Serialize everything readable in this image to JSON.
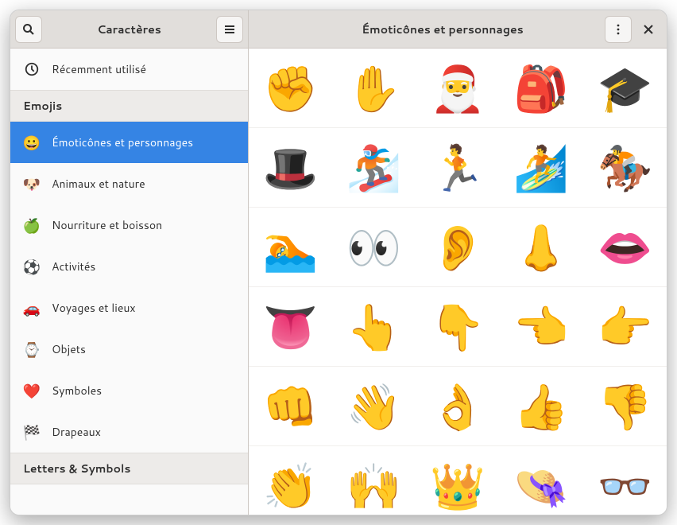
{
  "window": {
    "sidebar_title": "Caractères",
    "content_title": "Émoticônes et personnages"
  },
  "sidebar": {
    "recent": {
      "icon": "🕑",
      "label": "Récemment utilisé"
    },
    "section_emojis": "Emojis",
    "items": [
      {
        "icon": "😀",
        "label": "Émoticônes et personnages",
        "id": "cat-smileys",
        "active": true
      },
      {
        "icon": "🐶",
        "label": "Animaux et nature",
        "id": "cat-animals"
      },
      {
        "icon": "🍏",
        "label": "Nourriture et boisson",
        "id": "cat-food"
      },
      {
        "icon": "⚽",
        "label": "Activités",
        "id": "cat-activities"
      },
      {
        "icon": "🚗",
        "label": "Voyages et lieux",
        "id": "cat-travel"
      },
      {
        "icon": "⌚",
        "label": "Objets",
        "id": "cat-objects"
      },
      {
        "icon": "❤️",
        "label": "Symboles",
        "id": "cat-symbols"
      },
      {
        "icon": "🏁",
        "label": "Drapeaux",
        "id": "cat-flags"
      }
    ],
    "section_letters": "Letters & Symbols"
  },
  "grid": {
    "items": [
      "✊",
      "✋",
      "🎅",
      "🎒",
      "🎓",
      "🎩",
      "🏂",
      "🏃",
      "🏄",
      "🏇",
      "🏊",
      "👀",
      "👂",
      "👃",
      "👄",
      "👅",
      "👆",
      "👇",
      "👈",
      "👉",
      "👊",
      "👋",
      "👌",
      "👍",
      "👎",
      "👏",
      "🙌",
      "👑",
      "👒",
      "👓"
    ]
  }
}
